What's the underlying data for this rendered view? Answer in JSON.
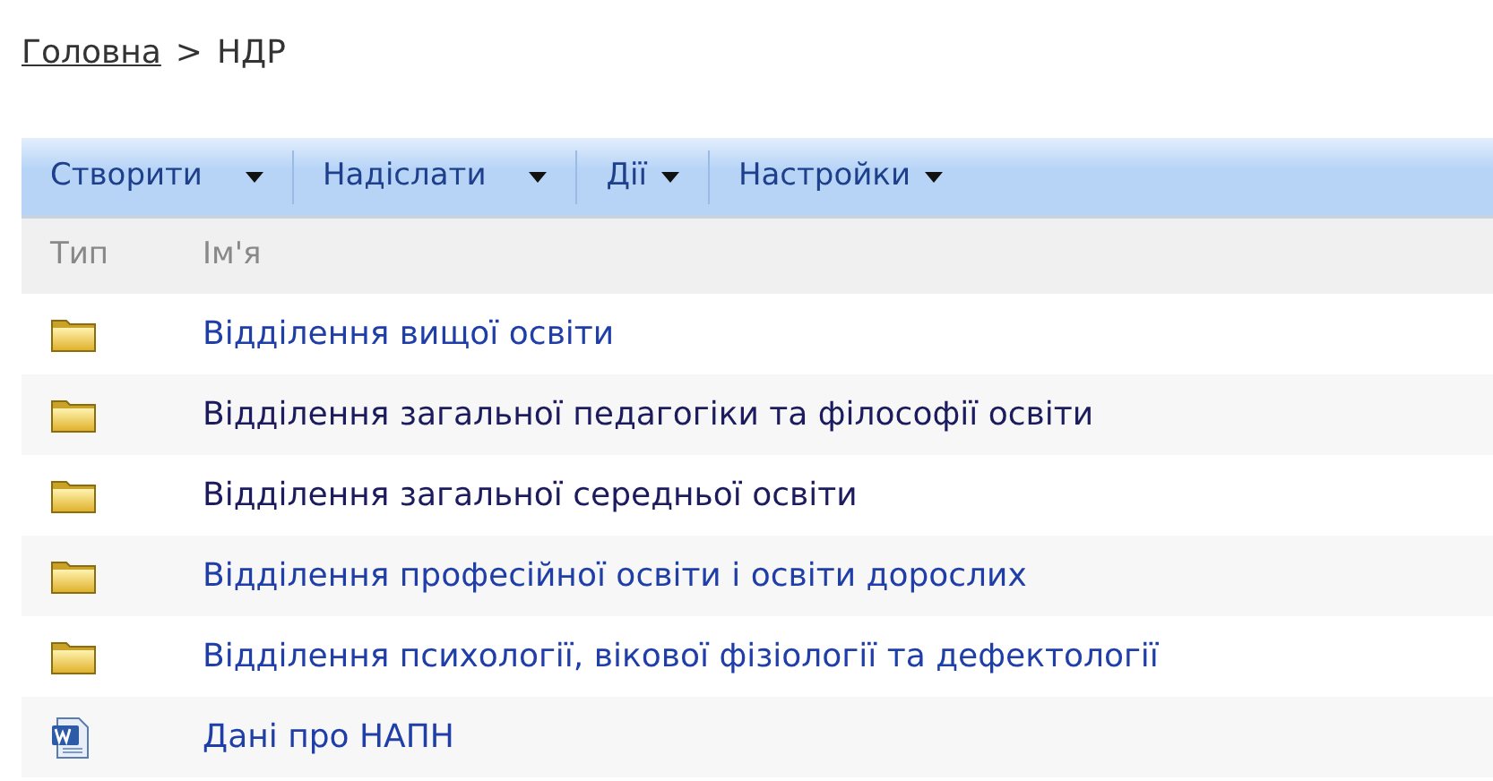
{
  "breadcrumb": [
    {
      "label": "Головна",
      "link": true
    },
    {
      "label": ">",
      "link": false
    },
    {
      "label": "НДР",
      "link": false
    }
  ],
  "toolbar": [
    {
      "label": "Створити",
      "split": true
    },
    {
      "label": "Надіслати",
      "split": true
    },
    {
      "label": "Дії",
      "split": false
    },
    {
      "label": "Настройки",
      "split": false
    }
  ],
  "table": {
    "columns": [
      "Тип",
      "Ім'я"
    ],
    "rows": [
      {
        "kind": "folder",
        "name": "Відділення вищої освіти",
        "visited": false
      },
      {
        "kind": "folder",
        "name": "Відділення загальної педагогіки та філософії освіти",
        "visited": true
      },
      {
        "kind": "folder",
        "name": "Відділення загальної середньої освіти",
        "visited": true
      },
      {
        "kind": "folder",
        "name": "Відділення професійної освіти і освіти дорослих",
        "visited": false
      },
      {
        "kind": "folder",
        "name": "Відділення психології, вікової фізіології та дефектології",
        "visited": false
      },
      {
        "kind": "word",
        "name": "Дані про НАПН",
        "visited": false
      }
    ]
  }
}
